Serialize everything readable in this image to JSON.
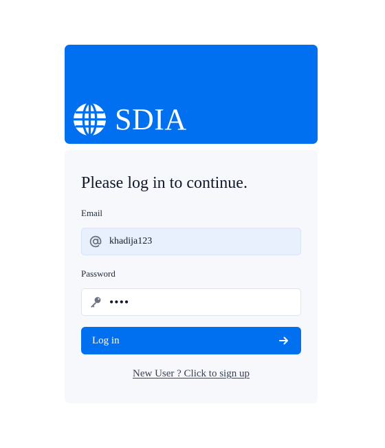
{
  "brand": {
    "name": "SDIA",
    "logo_icon": "globe-icon",
    "header_color": "#0070f0"
  },
  "login": {
    "heading": "Please log in to continue.",
    "email": {
      "label": "Email",
      "value": "khadija123",
      "icon": "at-sign-icon",
      "type": "email"
    },
    "password": {
      "label": "Password",
      "value": "••••",
      "icon": "key-icon",
      "type": "password"
    },
    "submit": {
      "label": "Log in",
      "icon": "arrow-right-icon"
    },
    "signup_link": "New User ? Click to sign up"
  },
  "colors": {
    "accent": "#0070f0",
    "card_background": "#f6f8fb",
    "filled_input_background": "#e8f0fe",
    "link_text": "#374151"
  }
}
